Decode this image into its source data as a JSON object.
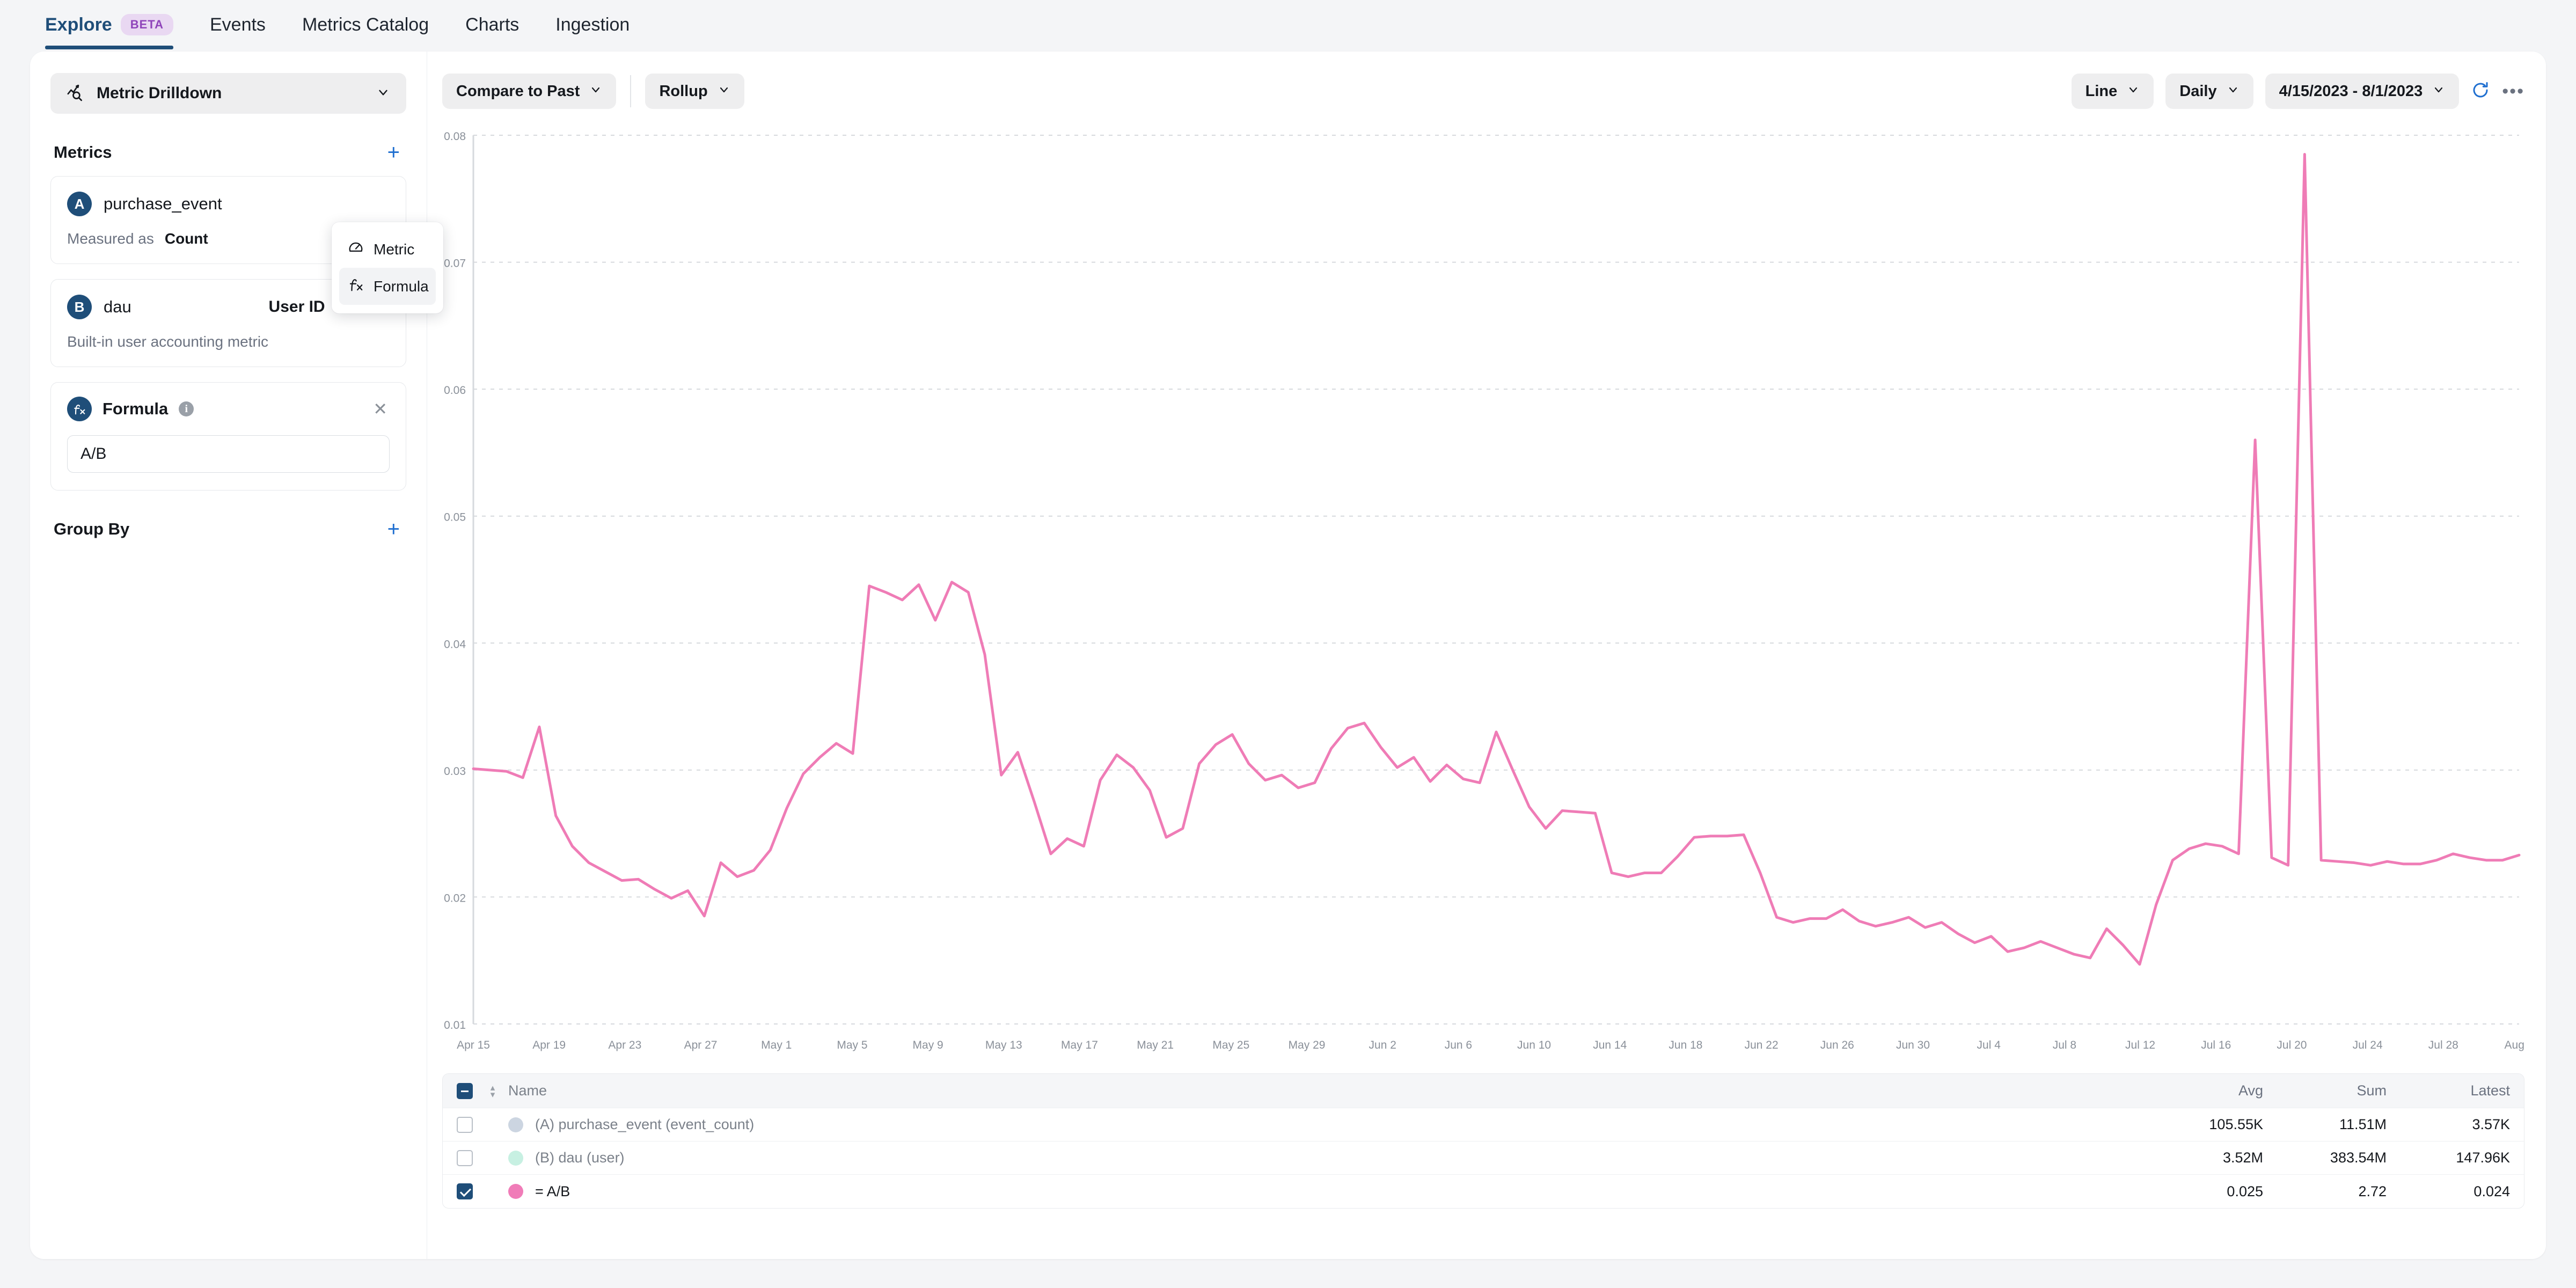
{
  "nav": {
    "items": [
      {
        "label": "Explore",
        "badge": "BETA",
        "active": true
      },
      {
        "label": "Events",
        "active": false
      },
      {
        "label": "Metrics Catalog",
        "active": false
      },
      {
        "label": "Charts",
        "active": false
      },
      {
        "label": "Ingestion",
        "active": false
      }
    ]
  },
  "sidebar": {
    "drilldown": {
      "label": "Metric Drilldown",
      "icon": "metric-drilldown-icon",
      "chevron": "⌄"
    },
    "metrics_header": "Metrics",
    "add_label": "+",
    "metrics": [
      {
        "badge": "A",
        "name": "purchase_event",
        "measured_label": "Measured as",
        "measured_value": "Count"
      },
      {
        "badge": "B",
        "name": "dau",
        "right_label": "User ID",
        "description": "Built-in user accounting metric",
        "close_icon": "✕",
        "more_icon": "•••"
      }
    ],
    "formula": {
      "badge": "ƒx",
      "title": "Formula",
      "info_icon": "i",
      "close_icon": "✕",
      "value": "A/B"
    },
    "group_by_header": "Group By",
    "group_by_add": "+",
    "popup": {
      "items": [
        {
          "label": "Metric",
          "icon": "gauge-icon",
          "selected": false
        },
        {
          "label": "Formula",
          "icon": "fx-icon",
          "selected": true
        }
      ]
    }
  },
  "toolbar": {
    "compare_label": "Compare to Past",
    "rollup_label": "Rollup",
    "chart_type_label": "Line",
    "granularity_label": "Daily",
    "date_range_label": "4/15/2023 - 8/1/2023",
    "chevron": "⌄",
    "refresh_icon": "refresh-icon",
    "more_icon": "•••"
  },
  "legend_table": {
    "columns": [
      "Name",
      "Avg",
      "Sum",
      "Latest"
    ],
    "rows": [
      {
        "checked": false,
        "color": "#ccd5e1",
        "name": "(A) purchase_event (event_count)",
        "avg": "105.55K",
        "sum": "11.51M",
        "latest": "3.57K"
      },
      {
        "checked": false,
        "color": "#c7f0e2",
        "name": "(B) dau (user)",
        "avg": "3.52M",
        "sum": "383.54M",
        "latest": "147.96K"
      },
      {
        "checked": true,
        "color": "#f07cb8",
        "name": "= A/B",
        "avg": "0.025",
        "sum": "2.72",
        "latest": "0.024"
      }
    ]
  },
  "chart_data": {
    "type": "line",
    "title": "",
    "xlabel": "",
    "ylabel": "",
    "grid": true,
    "legend_position": "bottom-table",
    "ylim": [
      0.01,
      0.08
    ],
    "yticks": [
      0.01,
      0.02,
      0.03,
      0.04,
      0.05,
      0.06,
      0.07,
      0.08
    ],
    "ytick_labels": [
      "0.01",
      "0.02",
      "0.03",
      "0.04",
      "0.05",
      "0.06",
      "0.07",
      "0.08"
    ],
    "xtick_labels": [
      "Apr 15",
      "Apr 19",
      "Apr 23",
      "Apr 27",
      "May 1",
      "May 5",
      "May 9",
      "May 13",
      "May 17",
      "May 21",
      "May 25",
      "May 29",
      "Jun 2",
      "Jun 6",
      "Jun 10",
      "Jun 14",
      "Jun 18",
      "Jun 22",
      "Jun 26",
      "Jun 30",
      "Jul 4",
      "Jul 8",
      "Jul 12",
      "Jul 16",
      "Jul 20",
      "Jul 24",
      "Jul 28",
      "Aug 1"
    ],
    "x_start": "Apr 15",
    "x_end": "Aug 1",
    "series": [
      {
        "name": "= A/B",
        "color": "#ef7cb6",
        "x": [
          "Apr 15",
          "Apr 16",
          "Apr 17",
          "Apr 18",
          "Apr 19",
          "Apr 20",
          "Apr 21",
          "Apr 22",
          "Apr 23",
          "Apr 24",
          "Apr 25",
          "Apr 26",
          "Apr 27",
          "Apr 28",
          "Apr 29",
          "Apr 30",
          "May 1",
          "May 2",
          "May 3",
          "May 4",
          "May 5",
          "May 6",
          "May 7",
          "May 8",
          "May 9",
          "May 10",
          "May 11",
          "May 12",
          "May 13",
          "May 14",
          "May 15",
          "May 16",
          "May 17",
          "May 18",
          "May 19",
          "May 20",
          "May 21",
          "May 22",
          "May 23",
          "May 24",
          "May 25",
          "May 26",
          "May 27",
          "May 28",
          "May 29",
          "May 30",
          "May 31",
          "Jun 1",
          "Jun 2",
          "Jun 3",
          "Jun 4",
          "Jun 5",
          "Jun 6",
          "Jun 7",
          "Jun 8",
          "Jun 9",
          "Jun 10",
          "Jun 11",
          "Jun 12",
          "Jun 13",
          "Jun 14",
          "Jun 15",
          "Jun 16",
          "Jun 17",
          "Jun 18",
          "Jun 19",
          "Jun 20",
          "Jun 21",
          "Jun 22",
          "Jun 23",
          "Jun 24",
          "Jun 25",
          "Jun 26",
          "Jun 27",
          "Jun 28",
          "Jun 29",
          "Jun 30",
          "Jul 1",
          "Jul 2",
          "Jul 3",
          "Jul 4",
          "Jul 5",
          "Jul 6",
          "Jul 7",
          "Jul 8",
          "Jul 9",
          "Jul 10",
          "Jul 11",
          "Jul 12",
          "Jul 13",
          "Jul 14",
          "Jul 15",
          "Jul 16",
          "Jul 17",
          "Jul 18",
          "Jul 19",
          "Jul 20",
          "Jul 21",
          "Jul 22",
          "Jul 23",
          "Jul 24",
          "Jul 25",
          "Jul 26",
          "Jul 27",
          "Jul 28",
          "Jul 29",
          "Jul 30",
          "Jul 31",
          "Aug 1"
        ],
        "values": [
          0.0301,
          0.03,
          0.0299,
          0.0294,
          0.0334,
          0.0264,
          0.024,
          0.0227,
          0.022,
          0.0213,
          0.0214,
          0.0206,
          0.0199,
          0.0205,
          0.0185,
          0.0227,
          0.0216,
          0.0221,
          0.0237,
          0.027,
          0.0297,
          0.031,
          0.0321,
          0.0313,
          0.0445,
          0.044,
          0.0434,
          0.0446,
          0.0418,
          0.0448,
          0.044,
          0.0391,
          0.0296,
          0.0314,
          0.0275,
          0.0234,
          0.0246,
          0.024,
          0.0292,
          0.0312,
          0.0302,
          0.0284,
          0.0247,
          0.0254,
          0.0305,
          0.032,
          0.0328,
          0.0305,
          0.0292,
          0.0296,
          0.0286,
          0.029,
          0.0317,
          0.0333,
          0.0337,
          0.0318,
          0.0302,
          0.031,
          0.0291,
          0.0304,
          0.0293,
          0.029,
          0.033,
          0.03,
          0.0271,
          0.0254,
          0.0268,
          0.0267,
          0.0266,
          0.0219,
          0.0216,
          0.0219,
          0.0219,
          0.0232,
          0.0247,
          0.0248,
          0.0248,
          0.0249,
          0.0219,
          0.0184,
          0.018,
          0.0183,
          0.0183,
          0.019,
          0.0181,
          0.0177,
          0.018,
          0.0184,
          0.0176,
          0.018,
          0.0171,
          0.0164,
          0.0169,
          0.0157,
          0.016,
          0.0165,
          0.016,
          0.0155,
          0.0152,
          0.0175,
          0.0162,
          0.0147,
          0.0194,
          0.0229,
          0.0238,
          0.0242,
          0.024,
          0.0234,
          0.056,
          0.0231,
          0.0225,
          0.0785,
          0.0229,
          0.0228,
          0.0227,
          0.0225,
          0.0228,
          0.0226,
          0.0226,
          0.0229,
          0.0234,
          0.0231,
          0.0229,
          0.0229,
          0.0233
        ],
        "peak_values": {
          "jul_16_spike": 0.056,
          "jul_20_spike": 0.0785
        }
      }
    ]
  }
}
